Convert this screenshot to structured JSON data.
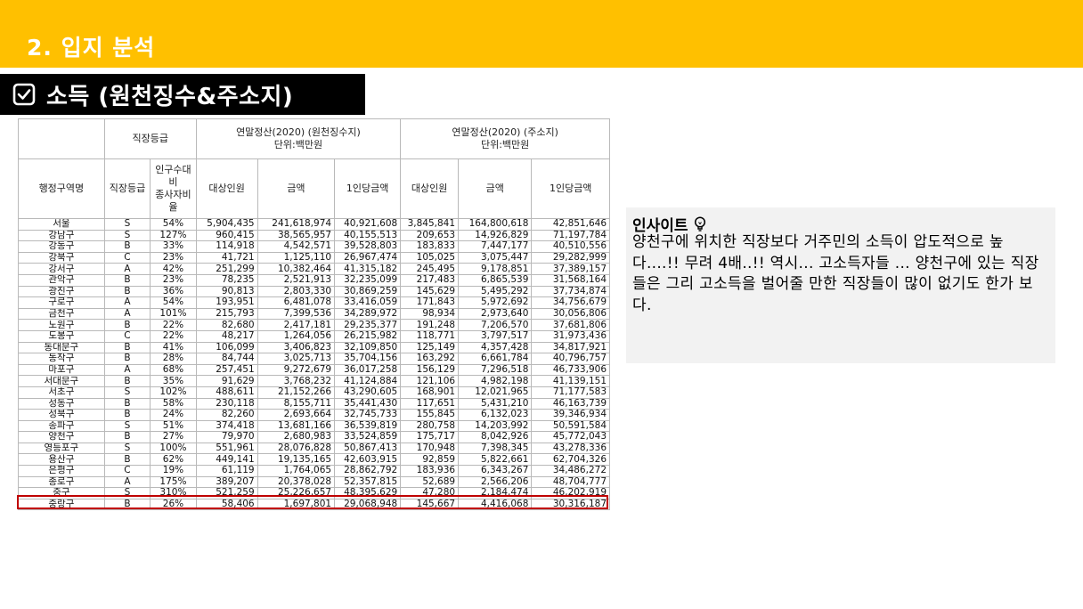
{
  "header": {
    "section_title": "2. 입지 분석"
  },
  "subtitle": {
    "text": "소득 (원천징수&주소지)",
    "icon": "checkbox-icon"
  },
  "table": {
    "group_headers": {
      "grade": "직장등급",
      "withholding": "연말정산(2020) (원천징수지)",
      "withholding_unit": "단위:백만원",
      "address": "연말정산(2020) (주소지)",
      "address_unit": "단위:백만원"
    },
    "columns": [
      "행정구역명",
      "직장등급",
      "인구수대비\n종사자비율",
      "대상인원",
      "금액",
      "1인당금액",
      "대상인원",
      "금액",
      "1인당금액"
    ],
    "rows": [
      [
        "서울",
        "S",
        "54%",
        "5,904,435",
        "241,618,974",
        "40,921,608",
        "3,845,841",
        "164,800,618",
        "42,851,646"
      ],
      [
        "강남구",
        "S",
        "127%",
        "960,415",
        "38,565,957",
        "40,155,513",
        "209,653",
        "14,926,829",
        "71,197,784"
      ],
      [
        "강동구",
        "B",
        "33%",
        "114,918",
        "4,542,571",
        "39,528,803",
        "183,833",
        "7,447,177",
        "40,510,556"
      ],
      [
        "강북구",
        "C",
        "23%",
        "41,721",
        "1,125,110",
        "26,967,474",
        "105,025",
        "3,075,447",
        "29,282,999"
      ],
      [
        "강서구",
        "A",
        "42%",
        "251,299",
        "10,382,464",
        "41,315,182",
        "245,495",
        "9,178,851",
        "37,389,157"
      ],
      [
        "관악구",
        "B",
        "23%",
        "78,235",
        "2,521,913",
        "32,235,099",
        "217,483",
        "6,865,539",
        "31,568,164"
      ],
      [
        "광진구",
        "B",
        "36%",
        "90,813",
        "2,803,330",
        "30,869,259",
        "145,629",
        "5,495,292",
        "37,734,874"
      ],
      [
        "구로구",
        "A",
        "54%",
        "193,951",
        "6,481,078",
        "33,416,059",
        "171,843",
        "5,972,692",
        "34,756,679"
      ],
      [
        "금천구",
        "A",
        "101%",
        "215,793",
        "7,399,536",
        "34,289,972",
        "98,934",
        "2,973,640",
        "30,056,806"
      ],
      [
        "노원구",
        "B",
        "22%",
        "82,680",
        "2,417,181",
        "29,235,377",
        "191,248",
        "7,206,570",
        "37,681,806"
      ],
      [
        "도봉구",
        "C",
        "22%",
        "48,217",
        "1,264,056",
        "26,215,982",
        "118,771",
        "3,797,517",
        "31,973,436"
      ],
      [
        "동대문구",
        "B",
        "41%",
        "106,099",
        "3,406,823",
        "32,109,850",
        "125,149",
        "4,357,428",
        "34,817,921"
      ],
      [
        "동작구",
        "B",
        "28%",
        "84,744",
        "3,025,713",
        "35,704,156",
        "163,292",
        "6,661,784",
        "40,796,757"
      ],
      [
        "마포구",
        "A",
        "68%",
        "257,451",
        "9,272,679",
        "36,017,258",
        "156,129",
        "7,296,518",
        "46,733,906"
      ],
      [
        "서대문구",
        "B",
        "35%",
        "91,629",
        "3,768,232",
        "41,124,884",
        "121,106",
        "4,982,198",
        "41,139,151"
      ],
      [
        "서초구",
        "S",
        "102%",
        "488,611",
        "21,152,266",
        "43,290,605",
        "168,901",
        "12,021,965",
        "71,177,583"
      ],
      [
        "성동구",
        "B",
        "58%",
        "230,118",
        "8,155,711",
        "35,441,430",
        "117,651",
        "5,431,210",
        "46,163,739"
      ],
      [
        "성북구",
        "B",
        "24%",
        "82,260",
        "2,693,664",
        "32,745,733",
        "155,845",
        "6,132,023",
        "39,346,934"
      ],
      [
        "송파구",
        "S",
        "51%",
        "374,418",
        "13,681,166",
        "36,539,819",
        "280,758",
        "14,203,992",
        "50,591,584"
      ],
      [
        "양천구",
        "B",
        "27%",
        "79,970",
        "2,680,983",
        "33,524,859",
        "175,717",
        "8,042,926",
        "45,772,043"
      ],
      [
        "영등포구",
        "S",
        "100%",
        "551,961",
        "28,076,828",
        "50,867,413",
        "170,948",
        "7,398,345",
        "43,278,336"
      ],
      [
        "용산구",
        "B",
        "62%",
        "449,141",
        "19,135,165",
        "42,603,915",
        "92,859",
        "5,822,661",
        "62,704,326"
      ],
      [
        "은평구",
        "C",
        "19%",
        "61,119",
        "1,764,065",
        "28,862,792",
        "183,936",
        "6,343,267",
        "34,486,272"
      ],
      [
        "종로구",
        "A",
        "175%",
        "389,207",
        "20,378,028",
        "52,357,815",
        "52,689",
        "2,566,206",
        "48,704,777"
      ],
      [
        "중구",
        "S",
        "310%",
        "521,259",
        "25,226,657",
        "48,395,629",
        "47,280",
        "2,184,474",
        "46,202,919"
      ],
      [
        "중랑구",
        "B",
        "26%",
        "58,406",
        "1,697,801",
        "29,068,948",
        "145,667",
        "4,416,068",
        "30,316,187"
      ]
    ],
    "highlighted_row": "양천구",
    "highlight_color": "#C00000"
  },
  "insight": {
    "title": "인사이트",
    "icon": "lightbulb-icon",
    "body": "양천구에 위치한 직장보다 거주민의 소득이 압도적으로 높다....!! 무려 4배..!! 역시... 고소득자들 ... 양천구에 있는 직장들은 그리 고소득을 벌어줄 만한 직장들이 많이 없기도 한가 보다."
  },
  "colors": {
    "accent": "#FFC000",
    "subtitle_bg": "#000000",
    "insight_bg": "#F2F2F2"
  }
}
